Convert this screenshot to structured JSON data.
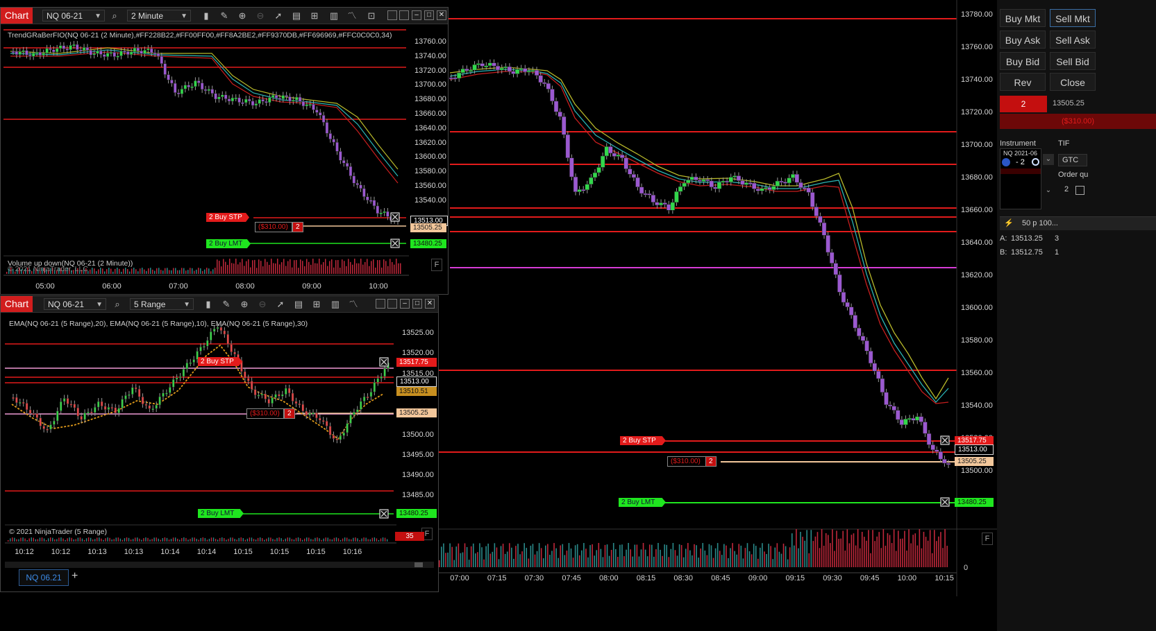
{
  "small_chart_1": {
    "tab": "Chart",
    "instrument": "NQ 06-21",
    "interval": "2 Minute",
    "indicator_label": "TrendGRaBerFIO(NQ 06-21 (2 Minute),#FF228B22,#FF00FF00,#FF8A2BE2,#FF9370DB,#FF696969,#FFC0C0C0,34)",
    "volume_label": "Volume up down(NQ 06-21 (2 Minute))",
    "copyright": "© 2021 NinjaTrader, LLC",
    "price_ticks": [
      "13760.00",
      "13740.00",
      "13720.00",
      "13700.00",
      "13680.00",
      "13660.00",
      "13640.00",
      "13620.00",
      "13600.00",
      "13580.00",
      "13560.00",
      "13540.00"
    ],
    "time_ticks": [
      "05:00",
      "06:00",
      "07:00",
      "08:00",
      "09:00",
      "10:00"
    ],
    "stop_label": "2  Buy STP",
    "pnl_label": "($310.00)",
    "pnl_qty": "2",
    "limit_label": "2  Buy LMT",
    "price_last": "13513.00",
    "price_entry": "13505.25",
    "price_limit": "13480.25",
    "f_button": "F"
  },
  "small_chart_2": {
    "tab": "Chart",
    "instrument": "NQ 06-21",
    "interval": "5 Range",
    "indicator_label": "EMA(NQ 06-21 (5 Range),20), EMA(NQ 06-21 (5 Range),10), EMA(NQ 06-21 (5 Range),30)",
    "volume_label": "© 2021 NinjaTrader (5 Range)",
    "price_ticks": [
      "13525.00",
      "13520.00",
      "13515.00",
      "13510.00",
      "13505.00",
      "13500.00",
      "13495.00",
      "13490.00",
      "13485.00"
    ],
    "time_ticks": [
      "10:12",
      "10:12",
      "10:13",
      "10:13",
      "10:14",
      "10:14",
      "10:15",
      "10:15",
      "10:15",
      "10:16"
    ],
    "stop_label": "2  Buy STP",
    "pnl_label": "($310.00)",
    "pnl_qty": "2",
    "limit_label": "2  Buy LMT",
    "price_stop": "13517.75",
    "price_last": "13513.00",
    "price_ema": "13510.51",
    "price_entry": "13505.25",
    "price_limit": "13480.25",
    "volume_value": "35",
    "f_button": "F",
    "tab_name": "NQ 06.21",
    "add_tab": "+"
  },
  "main_chart": {
    "price_ticks": [
      "13780.00",
      "13760.00",
      "13740.00",
      "13720.00",
      "13700.00",
      "13680.00",
      "13660.00",
      "13640.00",
      "13620.00",
      "13600.00",
      "13580.00",
      "13560.00",
      "13540.00",
      "13520.00",
      "13500.00"
    ],
    "time_ticks": [
      "07:00",
      "07:15",
      "07:30",
      "07:45",
      "08:00",
      "08:15",
      "08:30",
      "08:45",
      "09:00",
      "09:15",
      "09:30",
      "09:45",
      "10:00",
      "10:15"
    ],
    "stop_label": "2  Buy STP",
    "pnl_label": "($310.00)",
    "pnl_qty": "2",
    "limit_label": "2  Buy LMT",
    "price_stop": "13517.75",
    "price_last": "13513.00",
    "price_entry": "13505.25",
    "price_limit": "13480.25",
    "volume_zero": "0",
    "f_button": "F"
  },
  "order_panel": {
    "buy_mkt": "Buy Mkt",
    "sell_mkt": "Sell Mkt",
    "buy_ask": "Buy Ask",
    "sell_ask": "Sell Ask",
    "buy_bid": "Buy Bid",
    "sell_bid": "Sell Bid",
    "rev": "Rev",
    "close": "Close",
    "position_qty": "2",
    "position_price": "13505.25",
    "position_pnl": "($310.00)",
    "instrument_label": "Instrument",
    "tif_label": "TIF",
    "instrument_value": "NQ 2021-06",
    "instrument_pos": "- 2",
    "tif_value": "GTC",
    "order_qty_label": "Order qu",
    "order_qty_value": "2",
    "atm_value": "50 p 100...",
    "ask_label": "A:",
    "ask_price": "13513.25",
    "ask_size": "3",
    "bid_label": "B:",
    "bid_price": "13512.75",
    "bid_size": "1"
  },
  "colors": {
    "up_candle": "#32d74b",
    "down_candle": "#9b59d0",
    "stop": "#e31b1b",
    "limit": "#1fe61f",
    "entry": "#f3c79b",
    "line_red": "#e31b1b",
    "line_magenta": "#d63bd6"
  }
}
